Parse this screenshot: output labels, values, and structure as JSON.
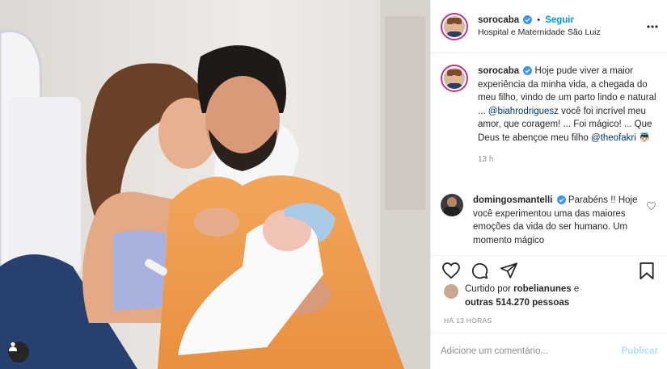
{
  "colors": {
    "accent": "#0095f6",
    "mention": "#00376b",
    "border": "#efefef",
    "muted": "#8e8e8e",
    "publish_disabled": "#b2dffc"
  },
  "photo": {
    "description_icon": "user-tag-icon"
  },
  "header": {
    "username": "sorocaba",
    "follow_label": "Seguir",
    "location": "Hospital e Maternidade São Luiz",
    "more_icon": "more-options-icon"
  },
  "caption": {
    "username": "sorocaba",
    "text_1": "Hoje pude viver a maior experiência da minha vida, a chegada do meu filho, vindo de um parto lindo e natural ... ",
    "mention_1": "@biahrodriguesz",
    "text_2": " você foi incrível meu amor, que coragem! ... Foi mágico! ... Que Deus te abençoe meu filho ",
    "mention_2": "@theofakri",
    "emoji": "👼🏻",
    "time": "13 h"
  },
  "comment": {
    "username": "domingosmantelli",
    "text": "Parabéns !! Hoje você experimentou uma das maiores emoções da vida do ser humano. Um momento mágico"
  },
  "actions": {
    "like_icon": "heart-icon",
    "comment_icon": "comment-icon",
    "share_icon": "share-icon",
    "save_icon": "bookmark-icon"
  },
  "likes": {
    "prefix": "Curtido por",
    "user": "robelianunes",
    "connector": "e",
    "others": "outras 514.270 pessoas"
  },
  "time_ago": "HÁ 13 HORAS",
  "add_comment": {
    "placeholder": "Adicione um comentário...",
    "publish_label": "Publicar"
  }
}
